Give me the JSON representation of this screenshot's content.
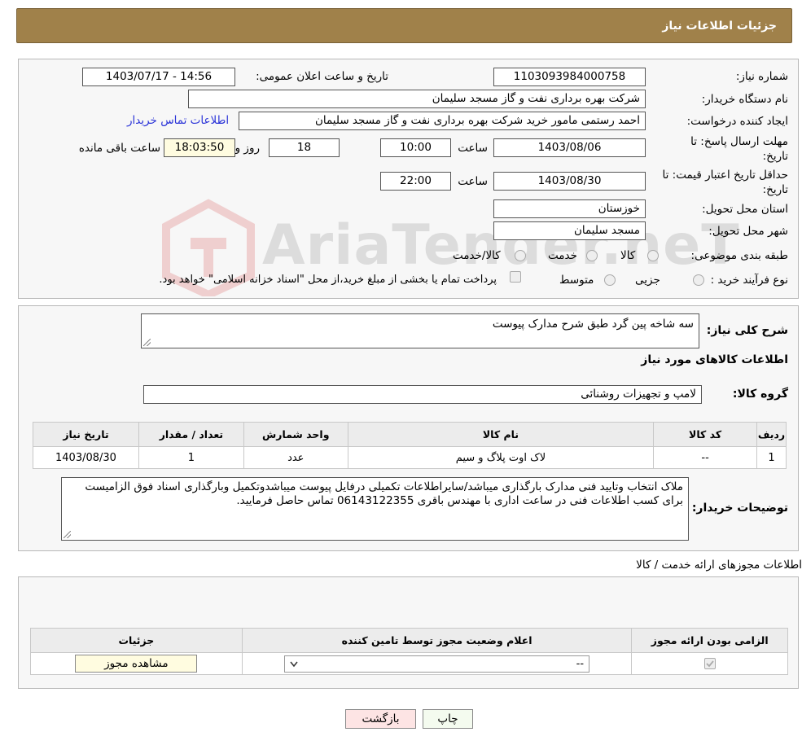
{
  "header": {
    "title": "جزئیات اطلاعات نیاز"
  },
  "watermark": "AriaTender.neT",
  "form": {
    "need_number_label": "شماره نیاز:",
    "need_number": "1103093984000758",
    "announce_label": "تاریخ و ساعت اعلان عمومی:",
    "announce_value": "1403/07/17 - 14:56",
    "buyer_org_label": "نام دستگاه خریدار:",
    "buyer_org": "شرکت بهره برداری نفت و گاز مسجد سلیمان",
    "requester_label": "ایجاد کننده درخواست:",
    "requester": "احمد رستمی مامور خرید شرکت بهره برداری نفت و گاز مسجد سلیمان",
    "contact_link": "اطلاعات تماس خریدار",
    "deadline_label_1": "مهلت ارسال پاسخ: تا",
    "deadline_label_2": "تاریخ:",
    "deadline_date": "1403/08/06",
    "time_label": "ساعت",
    "deadline_time": "10:00",
    "days_value": "18",
    "days_label": "روز و",
    "remaining_time": "18:03:50",
    "remaining_label": "ساعت باقی مانده",
    "validity_label_1": "حداقل تاریخ اعتبار قیمت: تا",
    "validity_label_2": "تاریخ:",
    "validity_date": "1403/08/30",
    "validity_time": "22:00",
    "province_label": "استان محل تحویل:",
    "province": "خوزستان",
    "city_label": "شهر محل تحویل:",
    "city": "مسجد سلیمان",
    "category_label": "طبقه بندی موضوعی:",
    "category_options": [
      "کالا",
      "خدمت",
      "کالا/خدمت"
    ],
    "process_label": "نوع فرآیند خرید :",
    "process_options": [
      "جزیی",
      "متوسط"
    ],
    "process_note": "پرداخت تمام یا بخشی از مبلغ خرید،از محل \"اسناد خزانه اسلامی\" خواهد بود."
  },
  "details": {
    "summary_label": "شرح کلی نیاز:",
    "summary": "سه شاخه پین گرد طبق شرح مدارک پیوست",
    "goods_title": "اطلاعات کالاهای مورد نیاز",
    "goods_group_label": "گروه کالا:",
    "goods_group": "لامپ و تجهیزات روشنائی",
    "table_headers": [
      "ردیف",
      "کد کالا",
      "نام کالا",
      "واحد شمارش",
      "تعداد / مقدار",
      "تاریخ نیاز"
    ],
    "table_rows": [
      [
        "1",
        "--",
        "لاک اوت پلاگ و سیم",
        "عدد",
        "1",
        "1403/08/30"
      ]
    ],
    "buyer_notes_label": "توضیحات خریدار:",
    "buyer_notes_line1": "ملاک انتخاب وتایید فنی مدارک بارگذاری میباشد/سایراطلاعات تکمیلی درفایل پیوست میباشدوتکمیل وبارگذاری اسناد فوق الزامیست",
    "buyer_notes_line2": "برای کسب اطلاعات فنی در ساعت اداری با مهندس  باقری 06143122355 تماس حاصل فرمایید."
  },
  "licenses": {
    "section_title": "اطلاعات مجوزهای ارائه خدمت / کالا",
    "headers": [
      "الزامی بودن ارائه مجوز",
      "اعلام وضعیت مجوز توسط تامین کننده",
      "جزئیات"
    ],
    "select_value": "--",
    "view_button": "مشاهده مجوز"
  },
  "buttons": {
    "print": "چاپ",
    "back": "بازگشت"
  }
}
